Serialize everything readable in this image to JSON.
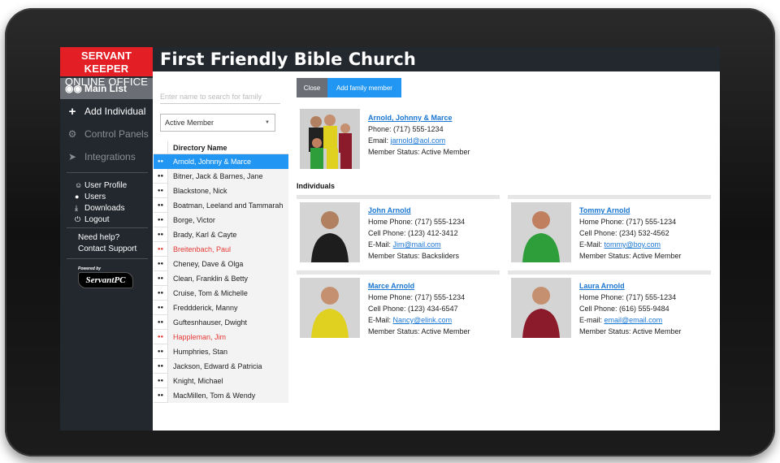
{
  "app": {
    "logo_line1": "SERVANT KEEPER",
    "logo_line2": "ONLINE OFFICE",
    "church_name": "First Friendly Bible Church"
  },
  "sidebar": {
    "main_list": "Main List",
    "add_individual": "Add Individual",
    "control_panels": "Control Panels",
    "integrations": "Integrations",
    "user_profile": "User Profile",
    "users": "Users",
    "downloads": "Downloads",
    "logout": "Logout",
    "need_help": "Need help?",
    "contact_support": "Contact Support",
    "powered_by": "Powered by",
    "brand": "ServantPC"
  },
  "list": {
    "search_placeholder": "Enter name to search for family",
    "filter_value": "Active Member",
    "column_header": "Directory Name",
    "rows": [
      {
        "name": "Arnold, Johnny & Marce",
        "selected": true,
        "red": false
      },
      {
        "name": "Bitner, Jack & Barnes, Jane",
        "selected": false,
        "red": false
      },
      {
        "name": "Blackstone, Nick",
        "selected": false,
        "red": false
      },
      {
        "name": "Boatman, Leeland and Tammarah",
        "selected": false,
        "red": false
      },
      {
        "name": "Borge, Victor",
        "selected": false,
        "red": false
      },
      {
        "name": "Brady, Karl & Cayte",
        "selected": false,
        "red": false
      },
      {
        "name": "Breitenbach, Paul",
        "selected": false,
        "red": true
      },
      {
        "name": "Cheney, Dave & Olga",
        "selected": false,
        "red": false
      },
      {
        "name": "Clean, Franklin & Betty",
        "selected": false,
        "red": false
      },
      {
        "name": "Cruise, Tom & Michelle",
        "selected": false,
        "red": false
      },
      {
        "name": "Freddderick, Manny",
        "selected": false,
        "red": false
      },
      {
        "name": "Guftesnhauser, Dwight",
        "selected": false,
        "red": false
      },
      {
        "name": "Happleman, Jim",
        "selected": false,
        "red": true
      },
      {
        "name": "Humphries, Stan",
        "selected": false,
        "red": false
      },
      {
        "name": "Jackson, Edward & Patricia",
        "selected": false,
        "red": false
      },
      {
        "name": "Knight, Michael",
        "selected": false,
        "red": false
      },
      {
        "name": "MacMillen, Tom & Wendy",
        "selected": false,
        "red": false
      }
    ]
  },
  "toolbar": {
    "close_label": "Close",
    "add_family_member_label": "Add family member"
  },
  "family": {
    "name": "Arnold, Johnny & Marce",
    "phone": "Phone: (717) 555-1234",
    "email_label": "Email: ",
    "email": "jarnold@aol.com",
    "status": "Member Status: Active Member"
  },
  "individuals_label": "Individuals",
  "individuals": [
    {
      "name": "John Arnold",
      "home_phone": "Home Phone: (717) 555-1234",
      "cell_phone": "Cell Phone: (123) 412-3412",
      "email_label": "E-Mail: ",
      "email": "Jim@mail.com",
      "status": "Member Status: Backsliders"
    },
    {
      "name": "Tommy Arnold",
      "home_phone": "Home Phone: (717) 555-1234",
      "cell_phone": "Cell Phone: (234) 532-4562",
      "email_label": "E-Mail: ",
      "email": "tommy@boy.com",
      "status": "Member Status: Active Member"
    },
    {
      "name": "Marce Arnold",
      "home_phone": "Home Phone: (717) 555-1234",
      "cell_phone": "Cell Phone: (123) 434-6547",
      "email_label": "E-Mail: ",
      "email": "Nancy@elink.com",
      "status": "Member Status: Active Member"
    },
    {
      "name": "Laura Arnold",
      "home_phone": "Home Phone: (717) 555-1234",
      "cell_phone": "Cell Phone: (616) 555-9484",
      "email_label": "E-mail: ",
      "email": "email@email.com",
      "status": "Member Status: Active Member"
    }
  ],
  "colors": {
    "brand_red": "#e31e24",
    "accent_blue": "#2196f3",
    "sidebar_dark": "#23282f",
    "inactive_red": "#e53935"
  }
}
